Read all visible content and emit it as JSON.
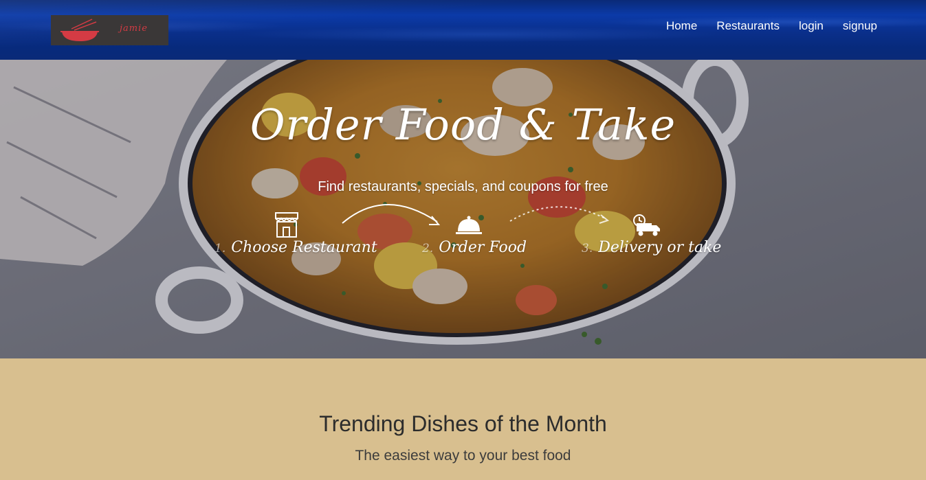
{
  "brand": {
    "logo_text": "jamie",
    "logo_bg": "#3a3737",
    "logo_accent": "#d43b44"
  },
  "nav": {
    "items": [
      {
        "label": "Home"
      },
      {
        "label": "Restaurants"
      },
      {
        "label": "login"
      },
      {
        "label": "signup"
      }
    ]
  },
  "hero": {
    "title": "Order Food & Take",
    "subtitle": "Find restaurants, specials, and coupons for free",
    "steps": [
      {
        "num": "1.",
        "label": "Choose Restaurant",
        "icon": "storefront-icon"
      },
      {
        "num": "2.",
        "label": "Order Food",
        "icon": "cloche-icon"
      },
      {
        "num": "3.",
        "label": "Delivery or take",
        "icon": "delivery-truck-icon"
      }
    ]
  },
  "trending": {
    "title": "Trending Dishes of the Month",
    "subtitle": "The easiest way to your best food"
  },
  "colors": {
    "navbar": "#0a2f8a",
    "section_bg": "#d8bf8f"
  }
}
